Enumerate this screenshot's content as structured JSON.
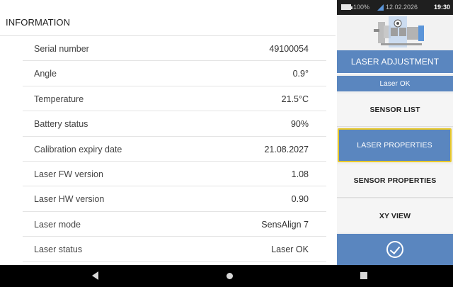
{
  "info": {
    "title": "INFORMATION",
    "rows": [
      {
        "label": "Serial number",
        "value": "49100054"
      },
      {
        "label": "Angle",
        "value": "0.9°"
      },
      {
        "label": "Temperature",
        "value": "21.5°C"
      },
      {
        "label": "Battery status",
        "value": "90%"
      },
      {
        "label": "Calibration expiry date",
        "value": "21.08.2027"
      },
      {
        "label": "Laser FW version",
        "value": "1.08"
      },
      {
        "label": "Laser HW version",
        "value": "0.90"
      },
      {
        "label": "Laser mode",
        "value": "SensAlign 7"
      },
      {
        "label": "Laser status",
        "value": "Laser OK"
      }
    ]
  },
  "status_bar": {
    "battery": "100%",
    "date": "12.02.2026",
    "time": "19:30"
  },
  "sidebar": {
    "laser_adjustment": "LASER ADJUSTMENT",
    "laser_ok": "Laser OK",
    "sensor_list": "SENSOR LIST",
    "laser_properties": "LASER PROPERTIES",
    "sensor_properties": "SENSOR PROPERTIES",
    "xy_view": "XY VIEW",
    "confirm_icon": "check-circle-icon"
  },
  "colors": {
    "accent": "#5a86bf",
    "highlight_border": "#e8c82a",
    "nav_bar": "#000000"
  }
}
